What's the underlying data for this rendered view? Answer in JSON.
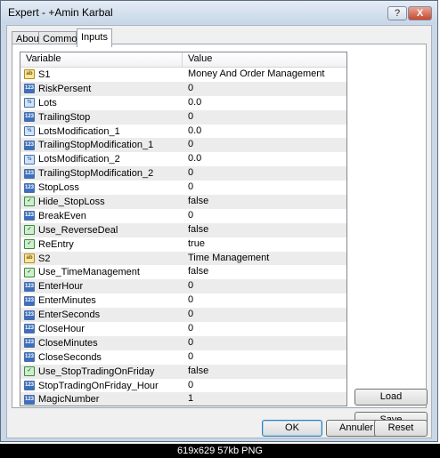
{
  "window": {
    "title": "Expert - +Amin Karbal",
    "help_label": "?",
    "close_label": "X"
  },
  "tabs": [
    {
      "label": "About"
    },
    {
      "label": "Common"
    },
    {
      "label": "Inputs"
    }
  ],
  "grid": {
    "headers": {
      "variable": "Variable",
      "value": "Value"
    },
    "rows": [
      {
        "icon": "string-icon",
        "icon_text": "ab",
        "name": "S1",
        "value": "Money And Order Management"
      },
      {
        "icon": "integer-icon",
        "icon_text": "123",
        "name": "RiskPersent",
        "value": "0"
      },
      {
        "icon": "double-icon",
        "icon_text": "½",
        "name": "Lots",
        "value": "0.0"
      },
      {
        "icon": "integer-icon",
        "icon_text": "123",
        "name": "TrailingStop",
        "value": "0"
      },
      {
        "icon": "double-icon",
        "icon_text": "½",
        "name": "LotsModification_1",
        "value": "0.0"
      },
      {
        "icon": "integer-icon",
        "icon_text": "123",
        "name": "TrailingStopModification_1",
        "value": "0"
      },
      {
        "icon": "double-icon",
        "icon_text": "½",
        "name": "LotsModification_2",
        "value": "0.0"
      },
      {
        "icon": "integer-icon",
        "icon_text": "123",
        "name": "TrailingStopModification_2",
        "value": "0"
      },
      {
        "icon": "integer-icon",
        "icon_text": "123",
        "name": "StopLoss",
        "value": "0"
      },
      {
        "icon": "bool-icon",
        "icon_text": "✓",
        "name": "Hide_StopLoss",
        "value": "false"
      },
      {
        "icon": "integer-icon",
        "icon_text": "123",
        "name": "BreakEven",
        "value": "0"
      },
      {
        "icon": "bool-icon",
        "icon_text": "✓",
        "name": "Use_ReverseDeal",
        "value": "false"
      },
      {
        "icon": "bool-icon",
        "icon_text": "✓",
        "name": "ReEntry",
        "value": "true"
      },
      {
        "icon": "string-icon",
        "icon_text": "ab",
        "name": "S2",
        "value": "Time Management"
      },
      {
        "icon": "bool-icon",
        "icon_text": "✓",
        "name": "Use_TimeManagement",
        "value": "false"
      },
      {
        "icon": "integer-icon",
        "icon_text": "123",
        "name": "EnterHour",
        "value": "0"
      },
      {
        "icon": "integer-icon",
        "icon_text": "123",
        "name": "EnterMinutes",
        "value": "0"
      },
      {
        "icon": "integer-icon",
        "icon_text": "123",
        "name": "EnterSeconds",
        "value": "0"
      },
      {
        "icon": "integer-icon",
        "icon_text": "123",
        "name": "CloseHour",
        "value": "0"
      },
      {
        "icon": "integer-icon",
        "icon_text": "123",
        "name": "CloseMinutes",
        "value": "0"
      },
      {
        "icon": "integer-icon",
        "icon_text": "123",
        "name": "CloseSeconds",
        "value": "0"
      },
      {
        "icon": "bool-icon",
        "icon_text": "✓",
        "name": "Use_StopTradingOnFriday",
        "value": "false"
      },
      {
        "icon": "integer-icon",
        "icon_text": "123",
        "name": "StopTradingOnFriday_Hour",
        "value": "0"
      },
      {
        "icon": "integer-icon",
        "icon_text": "123",
        "name": "MagicNumber",
        "value": "1"
      }
    ]
  },
  "buttons": {
    "load": "Load",
    "save": "Save",
    "ok": "OK",
    "cancel": "Annuler",
    "reset": "Reset"
  },
  "statusbar": {
    "text": "619x629  57kb  PNG"
  }
}
